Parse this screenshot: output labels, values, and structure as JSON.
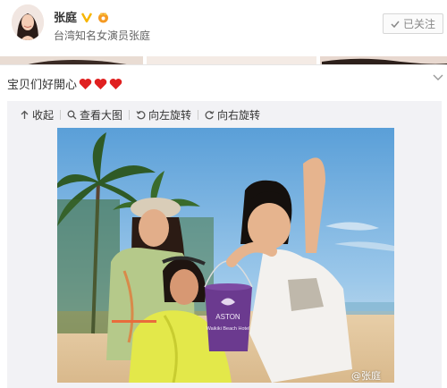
{
  "profile": {
    "name": "张庭",
    "description": "台湾知名女演员张庭",
    "follow_label": "已关注"
  },
  "post": {
    "text": "宝贝们好開心",
    "hearts": 3,
    "heart_color": "#e02020"
  },
  "media": {
    "toolbar": {
      "collapse": "收起",
      "view_large": "查看大图",
      "rotate_left": "向左旋转",
      "rotate_right": "向右旋转"
    },
    "bucket_text": "ASTON",
    "bucket_subtext": "Waikiki Beach Hotel",
    "watermark": "@张庭"
  },
  "colors": {
    "verified": "#f7b500",
    "accent": "#e96b3c"
  }
}
